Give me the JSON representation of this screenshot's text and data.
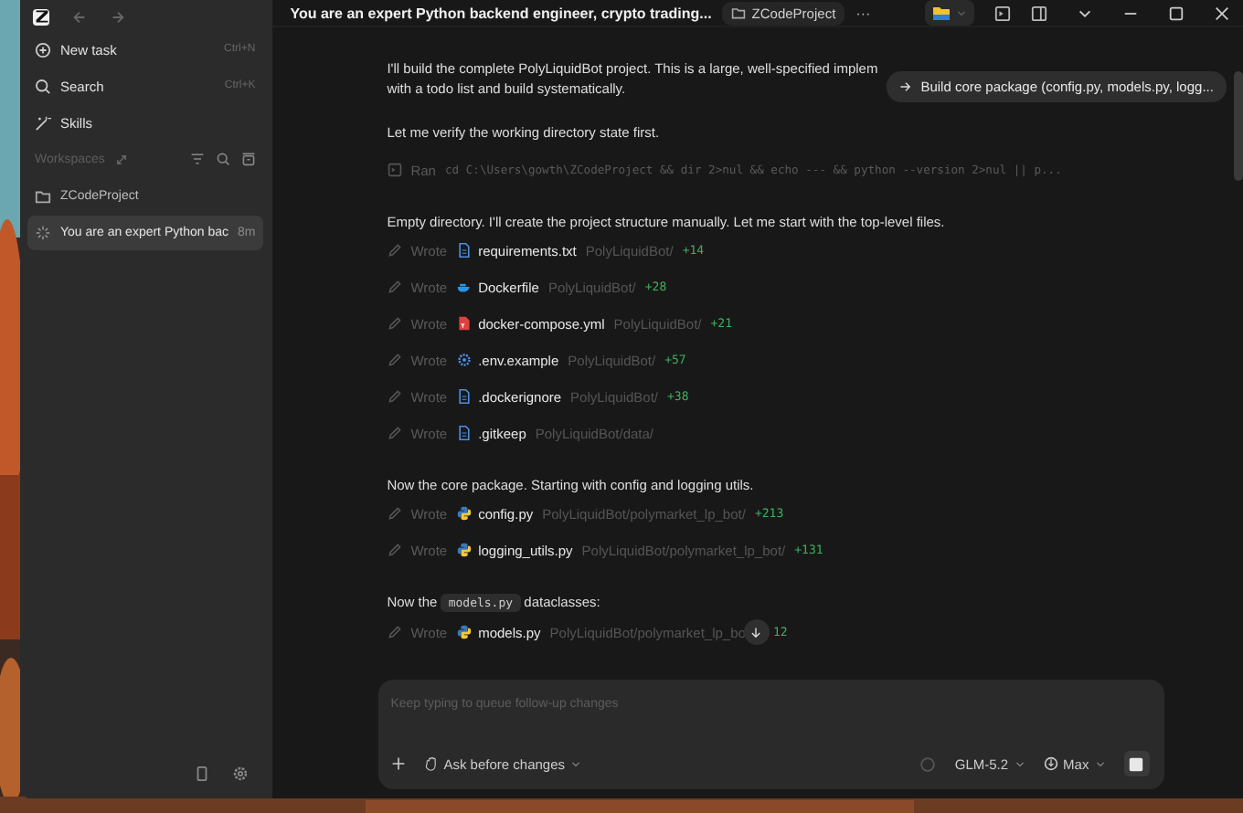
{
  "sidebar": {
    "items": [
      {
        "kind": "new",
        "label": "New task",
        "shortcut": "Ctrl+N"
      },
      {
        "kind": "search",
        "label": "Search",
        "shortcut": "Ctrl+K"
      },
      {
        "kind": "skills",
        "label": "Skills"
      }
    ],
    "workspaces_label": "Workspaces",
    "tree": [
      {
        "kind": "folder",
        "label": "ZCodeProject",
        "selected": false
      },
      {
        "kind": "task",
        "label": "You are an expert Python bac",
        "time": "8m",
        "selected": true
      }
    ]
  },
  "title_bar": {
    "title": "You are an expert Python backend engineer, crypto trading...",
    "project": "ZCodeProject",
    "more": "···"
  },
  "tooltip": "Build core package (config.py, models.py, logg...",
  "messages": [
    {
      "kind": "text",
      "text": "I'll build the complete PolyLiquidBot project. This is a large, well-specified implem"
    },
    {
      "kind": "continuation",
      "text": "with a todo list and build systematically."
    },
    {
      "kind": "text",
      "text": "Let me verify the working directory state first."
    },
    {
      "kind": "command",
      "verb": "Ran",
      "text": "cd C:\\Users\\gowth\\ZCodeProject && dir 2>nul && echo --- && python --version 2>nul || p..."
    },
    {
      "kind": "text",
      "text": "Empty directory. I'll create the project structure manually. Let me start with the top-level files."
    },
    {
      "kind": "text_file",
      "verb": "Wrote",
      "name": "requirements.txt",
      "path": "PolyLiquidBot/",
      "count": "+14"
    },
    {
      "kind": "docker_file",
      "verb": "Wrote",
      "name": "Dockerfile",
      "path": "PolyLiquidBot/",
      "count": "+28"
    },
    {
      "kind": "yaml_file",
      "verb": "Wrote",
      "name": "docker-compose.yml",
      "path": "PolyLiquidBot/",
      "count": "+21"
    },
    {
      "kind": "config_file",
      "verb": "Wrote",
      "name": ".env.example",
      "path": "PolyLiquidBot/",
      "count": "+57"
    },
    {
      "kind": "text_file",
      "verb": "Wrote",
      "name": ".dockerignore",
      "path": "PolyLiquidBot/",
      "count": "+38"
    },
    {
      "kind": "text_file",
      "verb": "Wrote",
      "name": ".gitkeep",
      "path": "PolyLiquidBot/data/"
    },
    {
      "kind": "text",
      "text": "Now the core package. Starting with config and logging utils."
    },
    {
      "kind": "python_file",
      "verb": "Wrote",
      "name": "config.py",
      "path": "PolyLiquidBot/polymarket_lp_bot/",
      "count": "+213"
    },
    {
      "kind": "python_file",
      "verb": "Wrote",
      "name": "logging_utils.py",
      "path": "PolyLiquidBot/polymarket_lp_bot/",
      "count": "+131"
    },
    {
      "kind": "code_text",
      "before": "Now the",
      "code": "models.py",
      "after": "dataclasses:"
    },
    {
      "kind": "python_file",
      "verb": "Wrote",
      "name": "models.py",
      "path": "PolyLiquidBot/polymarket_lp_bo",
      "count": "12"
    }
  ],
  "composer": {
    "placeholder": "Keep typing to queue follow-up changes",
    "mode": "Ask before changes",
    "model": "GLM-5.2",
    "effort": "Max"
  }
}
